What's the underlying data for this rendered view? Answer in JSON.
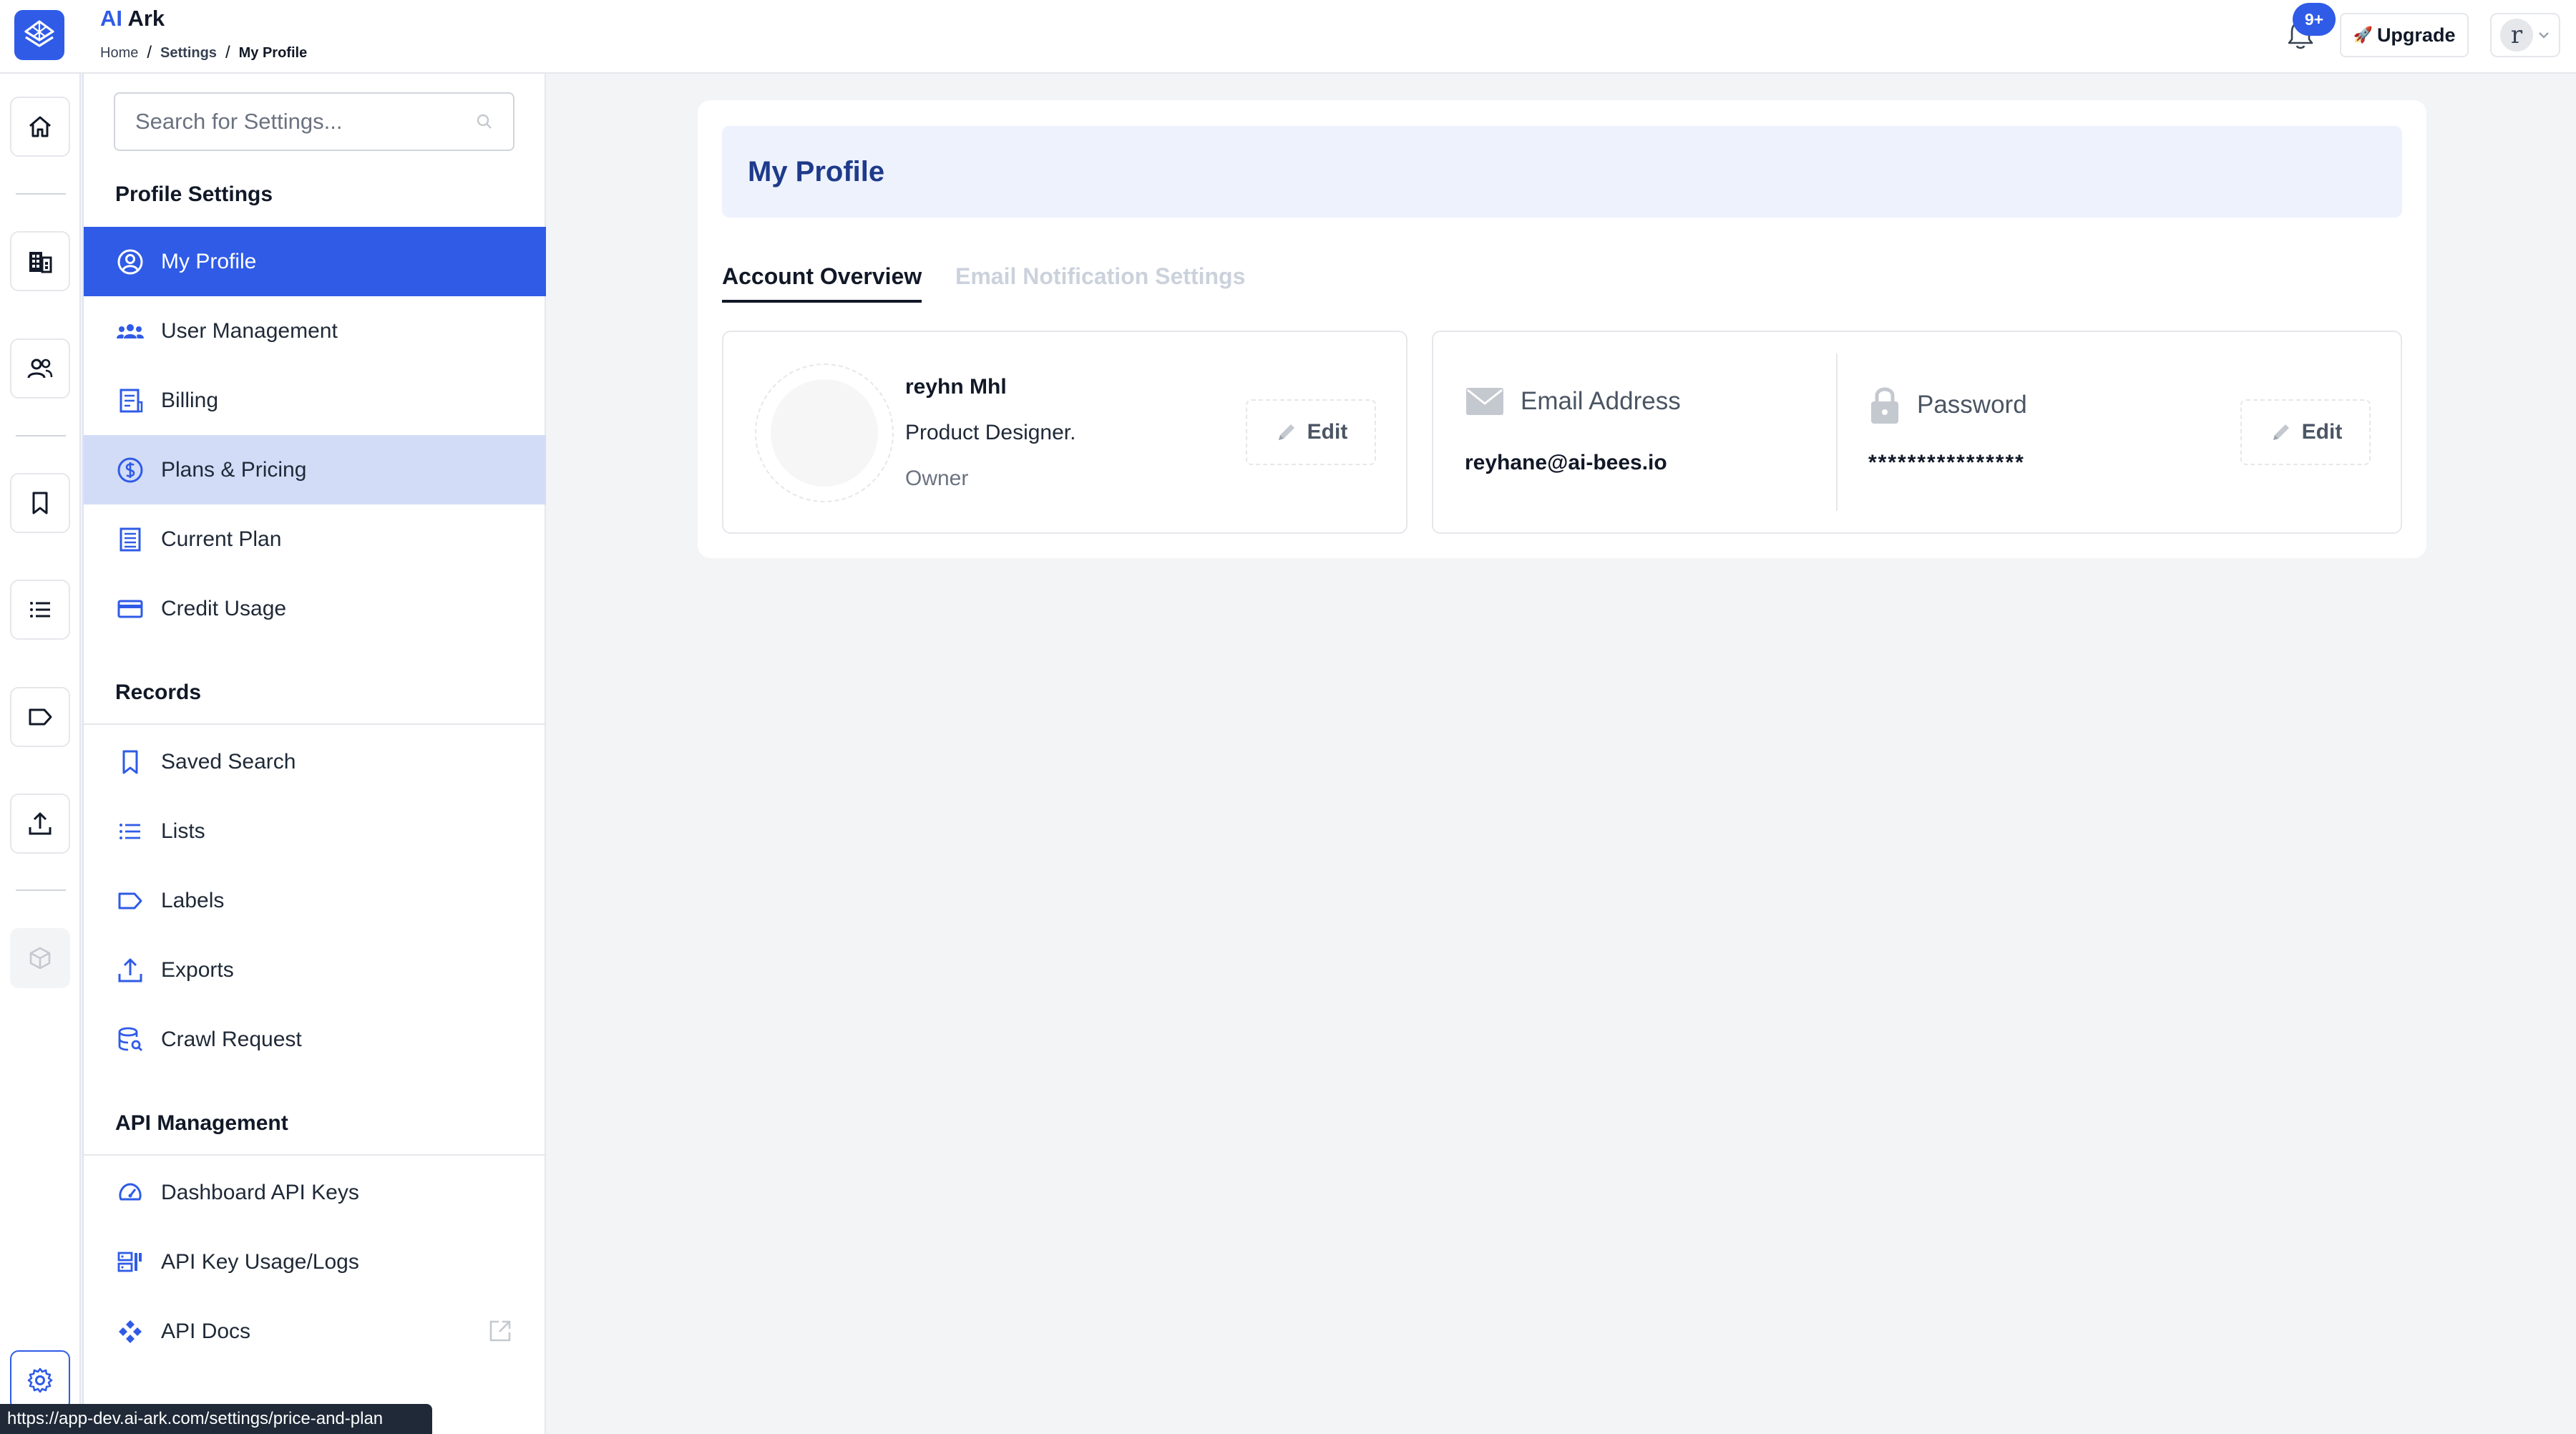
{
  "app": {
    "title_prefix": "AI",
    "title_main": "Ark"
  },
  "breadcrumb": [
    "Home",
    "Settings",
    "My Profile"
  ],
  "header": {
    "notification_count": "9+",
    "upgrade_label": "Upgrade",
    "upgrade_emoji": "🚀",
    "avatar_initial": "r"
  },
  "rail": {
    "icons": [
      "home-icon",
      "building-icon",
      "people-icon",
      "bookmark-icon",
      "list-icon",
      "label-icon",
      "upload-icon",
      "cube-icon",
      "gear-icon"
    ]
  },
  "sidebar": {
    "search_placeholder": "Search for Settings...",
    "sections": [
      {
        "title": "Profile Settings",
        "items": [
          {
            "label": "My Profile",
            "icon": "user-circle-icon"
          },
          {
            "label": "User Management",
            "icon": "group-icon"
          },
          {
            "label": "Billing",
            "icon": "receipt-icon"
          },
          {
            "label": "Plans & Pricing",
            "icon": "dollar-circle-icon"
          },
          {
            "label": "Current Plan",
            "icon": "document-list-icon"
          },
          {
            "label": "Credit Usage",
            "icon": "credit-card-icon"
          }
        ]
      },
      {
        "title": "Records",
        "items": [
          {
            "label": "Saved Search",
            "icon": "bookmark-icon"
          },
          {
            "label": "Lists",
            "icon": "list-icon"
          },
          {
            "label": "Labels",
            "icon": "label-icon"
          },
          {
            "label": "Exports",
            "icon": "upload-icon"
          },
          {
            "label": "Crawl Request",
            "icon": "database-search-icon"
          }
        ]
      },
      {
        "title": "API Management",
        "items": [
          {
            "label": "Dashboard API Keys",
            "icon": "speedometer-icon"
          },
          {
            "label": "API Key Usage/Logs",
            "icon": "key-usage-icon"
          },
          {
            "label": "API Docs",
            "icon": "api-docs-icon"
          }
        ]
      }
    ]
  },
  "main": {
    "page_title": "My Profile",
    "tabs": [
      "Account Overview",
      "Email Notification Settings"
    ],
    "profile": {
      "name": "reyhn Mhl",
      "role": "Product Designer.",
      "badge": "Owner",
      "edit_label": "Edit"
    },
    "account": {
      "email_label": "Email Address",
      "email_value": "reyhane@ai-bees.io",
      "password_label": "Password",
      "password_value": "****************",
      "edit_label": "Edit"
    }
  },
  "status_bar": {
    "url": "https://app-dev.ai-ark.com/settings/price-and-plan"
  },
  "colors": {
    "accent": "#2f5be7",
    "active_nav_bg": "#2f5be7",
    "hover_nav_bg": "#d3dcf7",
    "banner_bg": "#eef2fd",
    "title_color": "#1e3a8a"
  }
}
